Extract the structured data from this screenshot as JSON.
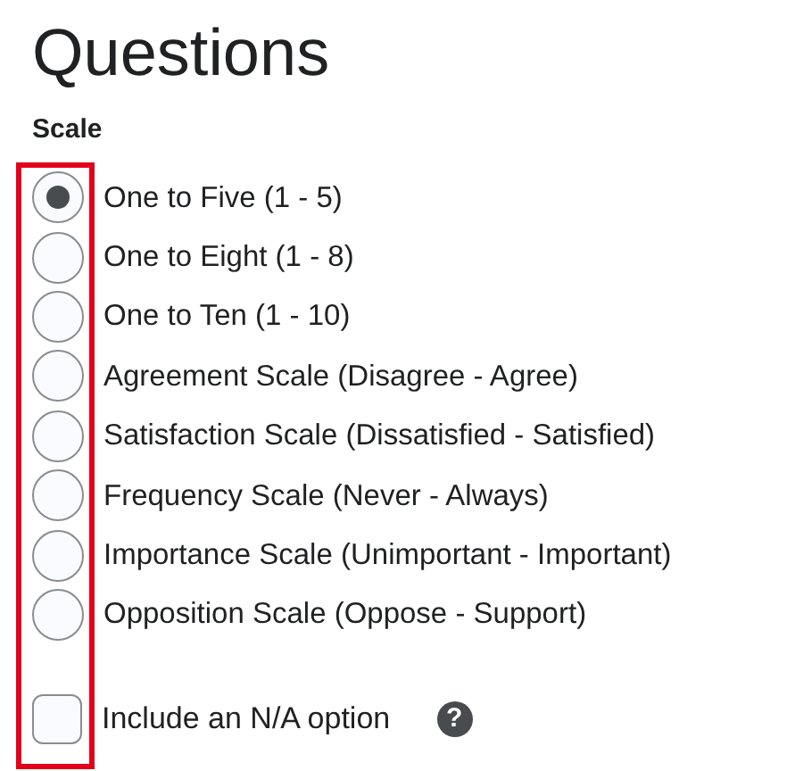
{
  "title": "Questions",
  "scale": {
    "label": "Scale",
    "options": [
      {
        "label": "One to Five (1 - 5)",
        "selected": true
      },
      {
        "label": "One to Eight (1 - 8)",
        "selected": false
      },
      {
        "label": "One to Ten (1 - 10)",
        "selected": false
      },
      {
        "label": "Agreement Scale (Disagree - Agree)",
        "selected": false
      },
      {
        "label": "Satisfaction Scale (Dissatisfied - Satisfied)",
        "selected": false
      },
      {
        "label": "Frequency Scale (Never - Always)",
        "selected": false
      },
      {
        "label": "Importance Scale (Unimportant - Important)",
        "selected": false
      },
      {
        "label": "Opposition Scale (Oppose - Support)",
        "selected": false
      }
    ]
  },
  "na_option": {
    "label": "Include an N/A option",
    "checked": false,
    "help": "?"
  }
}
